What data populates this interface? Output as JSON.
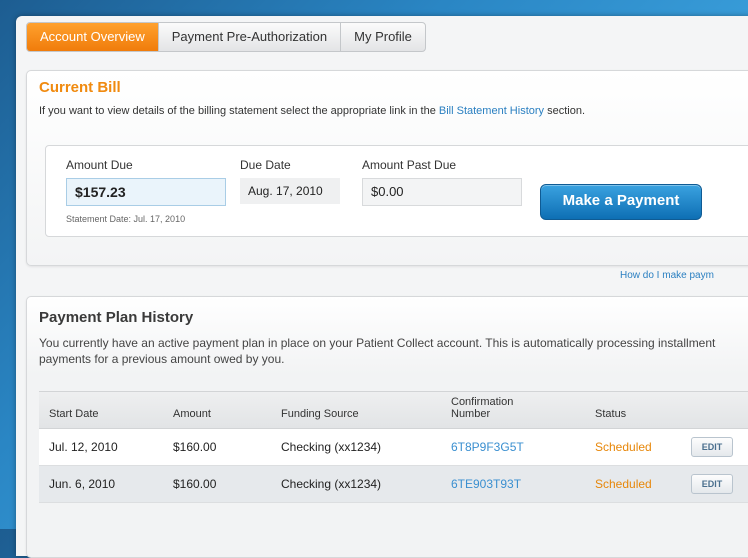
{
  "tabs": [
    {
      "label": "Account Overview",
      "active": true
    },
    {
      "label": "Payment Pre-Authorization",
      "active": false
    },
    {
      "label": "My Profile",
      "active": false
    }
  ],
  "current_bill": {
    "title": "Current Bill",
    "desc_prefix": "If you want to view details of the billing statement select the appropriate link in the ",
    "desc_link": "Bill Statement History",
    "desc_suffix": " section.",
    "amount_due_label": "Amount Due",
    "amount_due_value": "$157.23",
    "statement_date": "Statement Date: Jul. 17, 2010",
    "due_date_label": "Due Date",
    "due_date_value": "Aug. 17, 2010",
    "past_due_label": "Amount Past Due",
    "past_due_value": "$0.00",
    "pay_button": "Make a Payment"
  },
  "help_link": "How do I make paym",
  "payment_plan": {
    "title": "Payment Plan History",
    "desc": "You currently have an active payment plan in place on your Patient Collect account. This is automatically processing installment payments for a previous amount owed by you.",
    "columns": {
      "start_date": "Start Date",
      "amount": "Amount",
      "funding_source": "Funding Source",
      "confirmation": "Confirmation Number",
      "status": "Status"
    },
    "rows": [
      {
        "start_date": "Jul. 12, 2010",
        "amount": "$160.00",
        "funding_source": "Checking (xx1234)",
        "confirmation": "6T8P9F3G5T",
        "status": "Scheduled",
        "action": "EDIT"
      },
      {
        "start_date": "Jun. 6, 2010",
        "amount": "$160.00",
        "funding_source": "Checking (xx1234)",
        "confirmation": "6TE903T93T",
        "status": "Scheduled",
        "action": "EDIT"
      }
    ]
  },
  "colors": {
    "accent_orange": "#f07c0b",
    "link_blue": "#2a7fc1",
    "button_blue": "#0e6fb4"
  }
}
